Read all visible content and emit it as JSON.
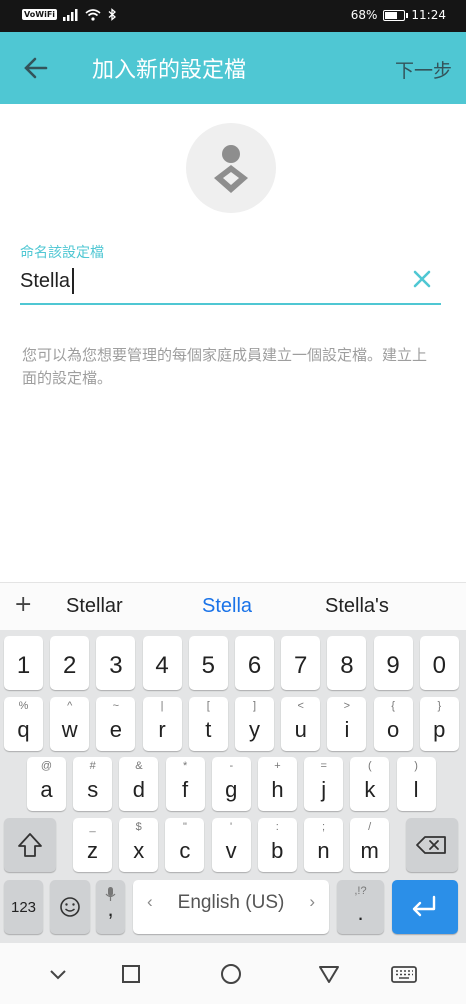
{
  "status_bar": {
    "network_badge": "VoWiFi",
    "battery_text": "68%",
    "battery_level": 0.68,
    "time": "11:24"
  },
  "header": {
    "title": "加入新的設定檔",
    "next_label": "下一步",
    "background": "#4fc7d3"
  },
  "profile_form": {
    "label": "命名該設定檔",
    "value": "Stella",
    "helper_text": "您可以為您想要管理的每個家庭成員建立一個設定檔。建立上面的設定檔。"
  },
  "suggestions": {
    "items": [
      "Stellar",
      "Stella",
      "Stella's"
    ],
    "highlight_color": "#1a73e8"
  },
  "keyboard": {
    "number_row": [
      "1",
      "2",
      "3",
      "4",
      "5",
      "6",
      "7",
      "8",
      "9",
      "0"
    ],
    "row1": [
      {
        "key": "q",
        "hint": "%"
      },
      {
        "key": "w",
        "hint": "^"
      },
      {
        "key": "e",
        "hint": "~"
      },
      {
        "key": "r",
        "hint": "|"
      },
      {
        "key": "t",
        "hint": "["
      },
      {
        "key": "y",
        "hint": "]"
      },
      {
        "key": "u",
        "hint": "<"
      },
      {
        "key": "i",
        "hint": ">"
      },
      {
        "key": "o",
        "hint": "{"
      },
      {
        "key": "p",
        "hint": "}"
      }
    ],
    "row2": [
      {
        "key": "a",
        "hint": "@"
      },
      {
        "key": "s",
        "hint": "#"
      },
      {
        "key": "d",
        "hint": "&"
      },
      {
        "key": "f",
        "hint": "*"
      },
      {
        "key": "g",
        "hint": "-"
      },
      {
        "key": "h",
        "hint": "+"
      },
      {
        "key": "j",
        "hint": "="
      },
      {
        "key": "k",
        "hint": "("
      },
      {
        "key": "l",
        "hint": ")"
      }
    ],
    "row3": [
      {
        "key": "z",
        "hint": "_"
      },
      {
        "key": "x",
        "hint": "$"
      },
      {
        "key": "c",
        "hint": "\""
      },
      {
        "key": "v",
        "hint": "'"
      },
      {
        "key": "b",
        "hint": ":"
      },
      {
        "key": "n",
        "hint": ";"
      },
      {
        "key": "m",
        "hint": "/"
      }
    ],
    "symbols_label": "123",
    "comma": ",",
    "space_label": "English (US)",
    "period": ".",
    "period_hint": ",!?",
    "accent_color": "#2b8fe8"
  },
  "icons": {
    "back": "arrow-left-icon",
    "clear": "close-icon",
    "avatar": "person-icon",
    "shift": "shift-icon",
    "backspace": "backspace-icon",
    "emoji": "emoji-icon",
    "mic": "mic-icon",
    "enter": "enter-icon",
    "nav_back": "nav-back-icon",
    "nav_home": "nav-home-icon",
    "nav_recents": "nav-recents-icon",
    "keyboard": "keyboard-icon"
  }
}
